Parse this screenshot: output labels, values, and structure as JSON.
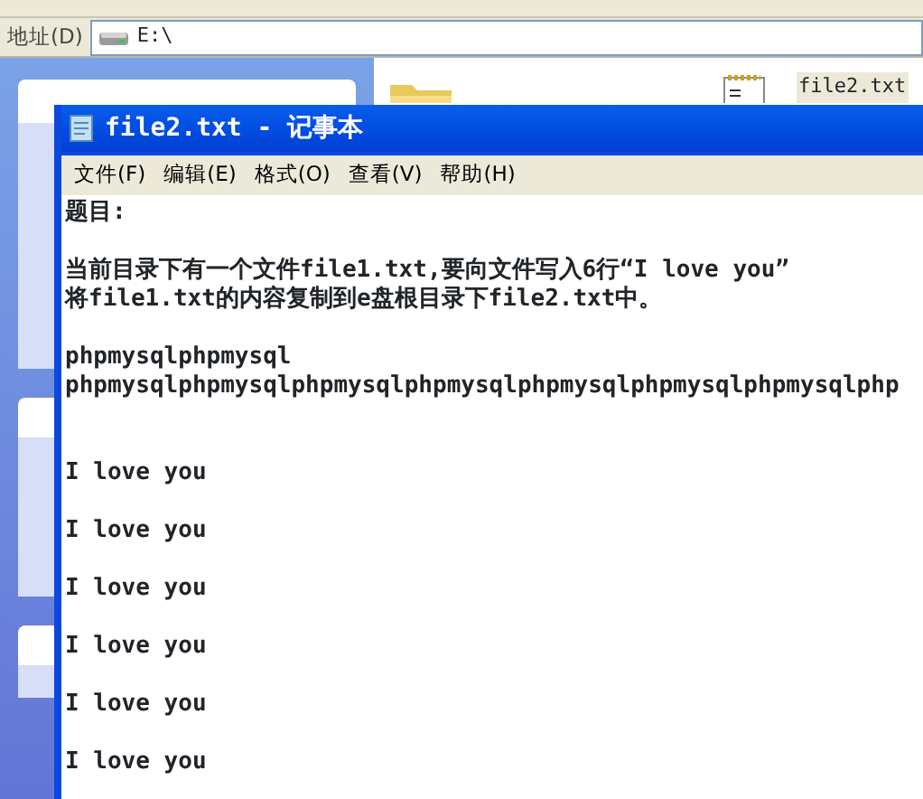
{
  "address_bar": {
    "label": "地址(D)",
    "value": "E:\\"
  },
  "files": [
    {
      "kind": "folder"
    },
    {
      "kind": "text_file",
      "name": "file2.txt",
      "selected": true
    }
  ],
  "notepad": {
    "title": "file2.txt - 记事本",
    "menu": [
      "文件(F)",
      "编辑(E)",
      "格式(O)",
      "查看(V)",
      "帮助(H)"
    ],
    "lines": [
      {
        "kind": "text",
        "text": "题目:"
      },
      {
        "kind": "blank"
      },
      {
        "kind": "text",
        "text": "当前目录下有一个文件file1.txt,要向文件写入6行“I love you”"
      },
      {
        "kind": "text",
        "text": "将file1.txt的内容复制到e盘根目录下file2.txt中。"
      },
      {
        "kind": "blank"
      },
      {
        "kind": "text",
        "text": "phpmysqlphpmysql"
      },
      {
        "kind": "text",
        "text": "phpmysqlphpmysqlphpmysqlphpmysqlphpmysqlphpmysqlphpmysqlphp"
      },
      {
        "kind": "blank"
      },
      {
        "kind": "blank"
      },
      {
        "kind": "text",
        "text": "I love you"
      },
      {
        "kind": "blank"
      },
      {
        "kind": "text",
        "text": "I love you"
      },
      {
        "kind": "blank"
      },
      {
        "kind": "text",
        "text": "I love you"
      },
      {
        "kind": "blank"
      },
      {
        "kind": "text",
        "text": "I love you"
      },
      {
        "kind": "blank"
      },
      {
        "kind": "text",
        "text": "I love you"
      },
      {
        "kind": "blank"
      },
      {
        "kind": "text",
        "text": "I love you"
      }
    ]
  }
}
